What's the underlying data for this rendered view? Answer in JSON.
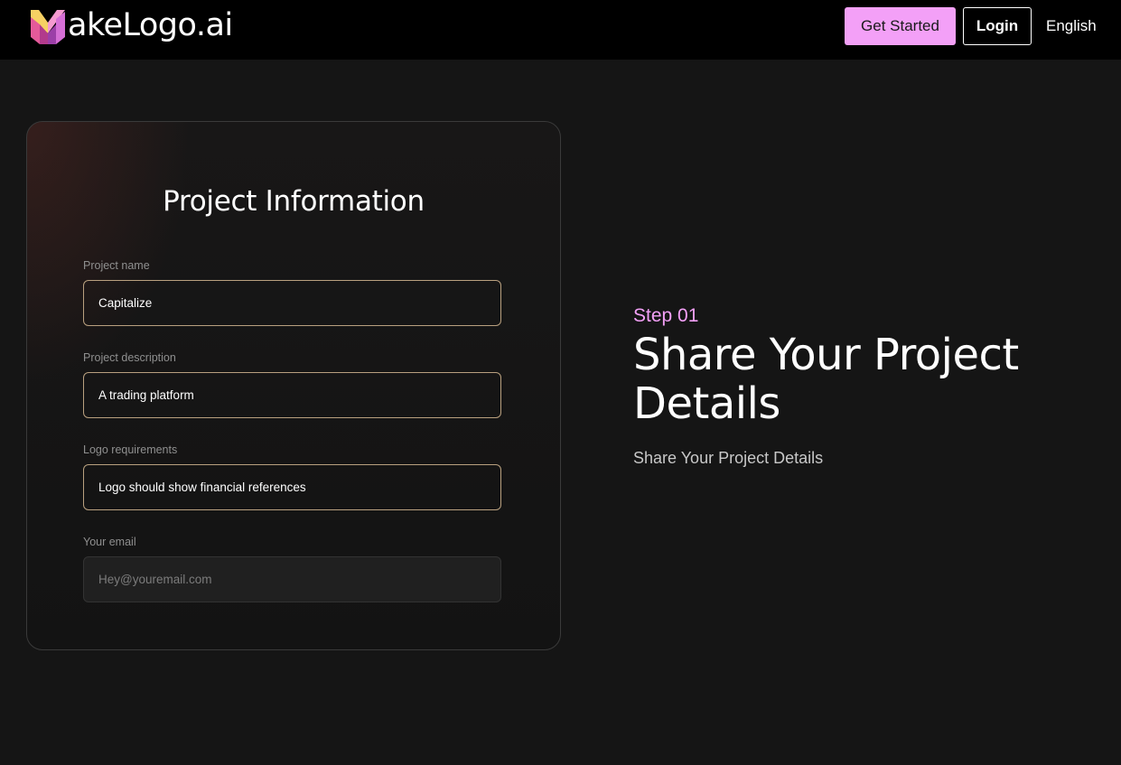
{
  "header": {
    "logo_text": "akeLogo.ai",
    "get_started_label": "Get Started",
    "login_label": "Login",
    "language_label": "English"
  },
  "form": {
    "title": "Project Information",
    "fields": [
      {
        "label": "Project name",
        "value": "Capitalize",
        "placeholder": ""
      },
      {
        "label": "Project description",
        "value": "A trading platform",
        "placeholder": ""
      },
      {
        "label": "Logo requirements",
        "value": "Logo should show financial references",
        "placeholder": ""
      },
      {
        "label": "Your email",
        "value": "",
        "placeholder": "Hey@youremail.com"
      }
    ]
  },
  "step": {
    "label": "Step 01",
    "title": "Share Your Project Details",
    "subtitle": "Share Your Project Details"
  },
  "colors": {
    "accent": "#f3a0f7",
    "input_border": "#b9a07f",
    "background": "#151515",
    "header_bg": "#000000"
  },
  "icons": {
    "logo": "makelogo-m-icon"
  }
}
